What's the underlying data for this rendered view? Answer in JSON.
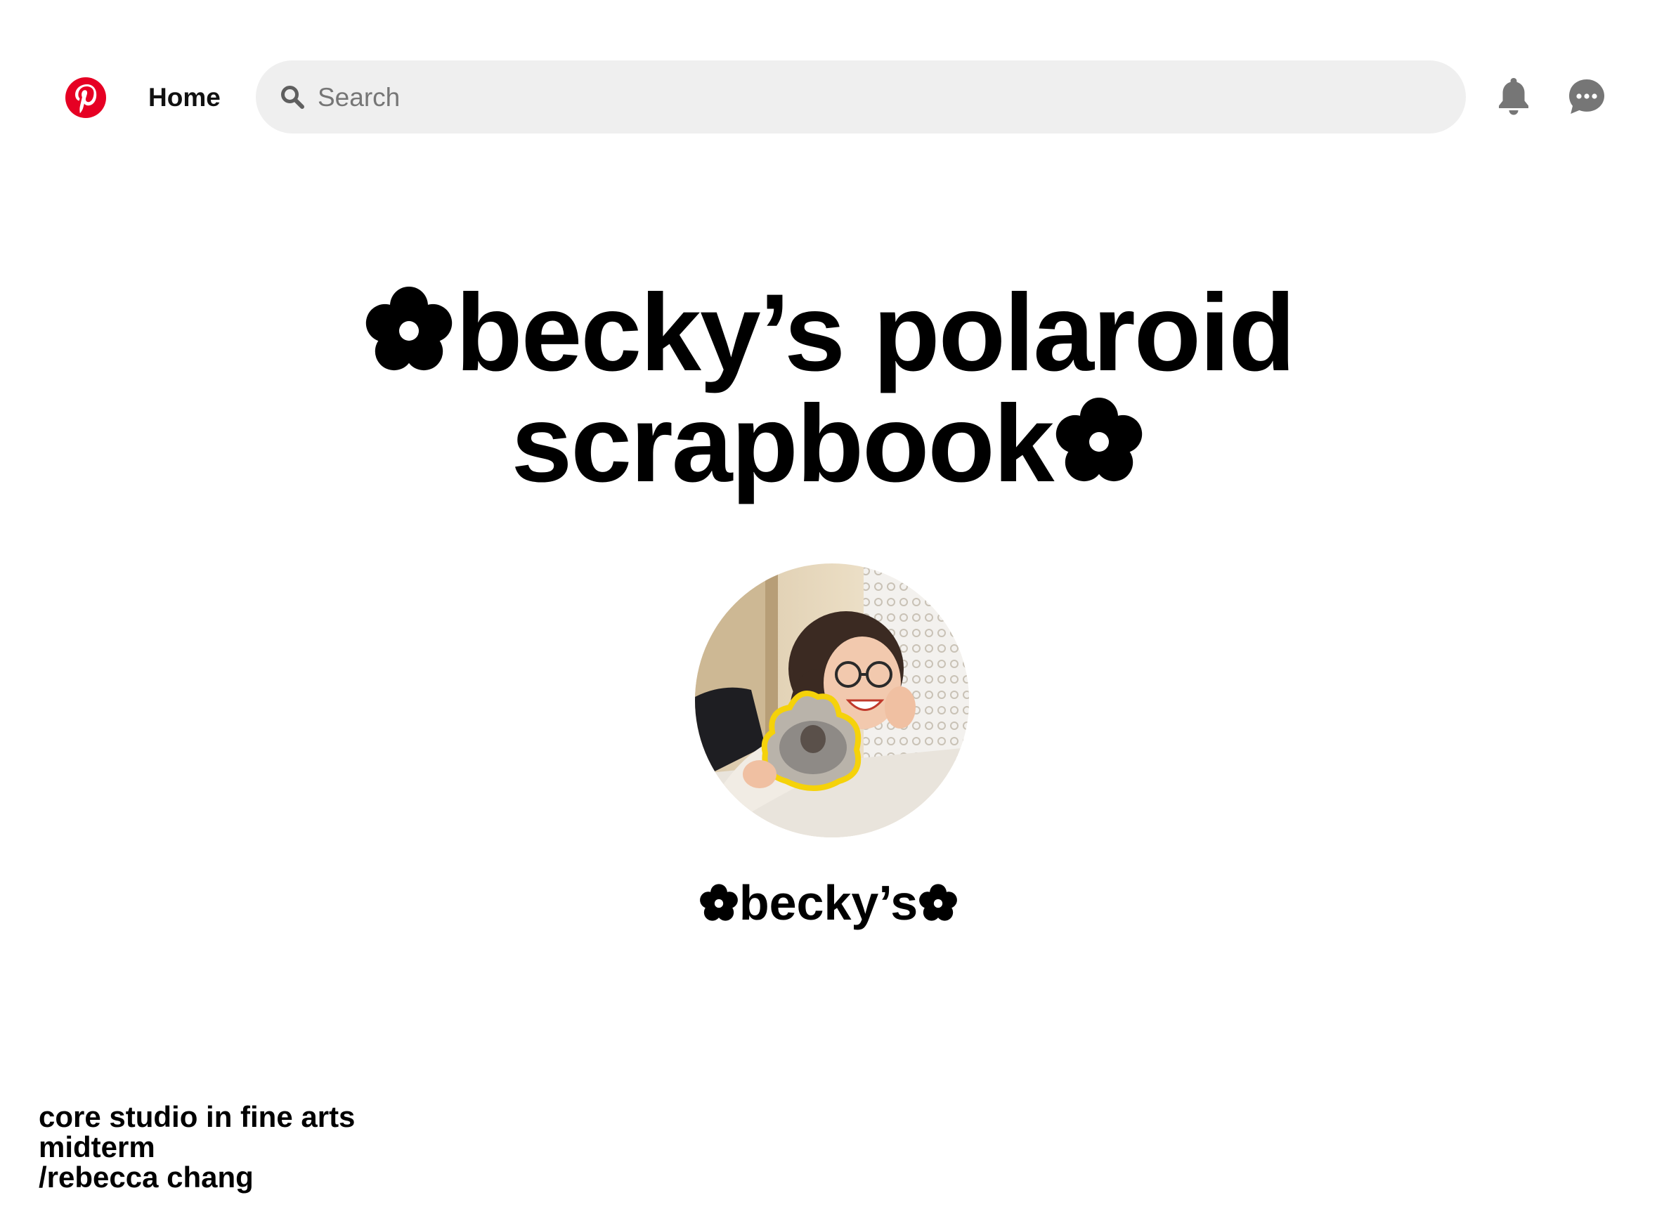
{
  "header": {
    "home_label": "Home",
    "search_placeholder": "Search",
    "search_value": "",
    "brand_color": "#e60023",
    "icons": [
      "pinterest-logo",
      "search-icon",
      "notifications-bell-icon",
      "messages-icon"
    ]
  },
  "board": {
    "title_line1": "becky’s polaroid",
    "title_line2": "scrapbook",
    "flower_glyph": "✿"
  },
  "profile": {
    "name": "becky’s"
  },
  "credits": {
    "line1": "core studio in fine arts",
    "line2": "midterm",
    "line3": "/rebecca chang"
  }
}
